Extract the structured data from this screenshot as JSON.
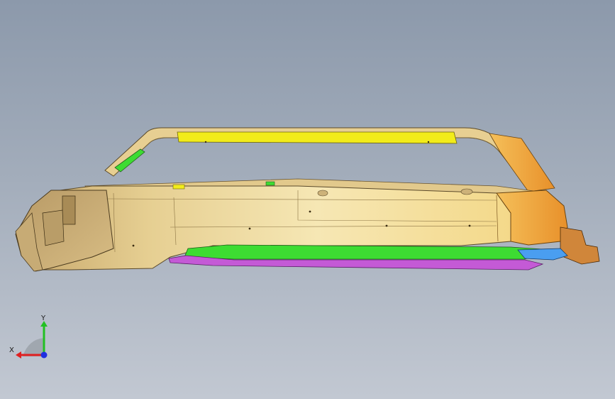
{
  "viewport": {
    "background_top": "#8c99ab",
    "background_bottom": "#c2c8d2"
  },
  "model": {
    "parts": [
      {
        "name": "body-panel",
        "color": "#f0dc9a"
      },
      {
        "name": "rear-section",
        "color": "#f0a53a"
      },
      {
        "name": "roof-rail-strip",
        "color": "#f2ec1a"
      },
      {
        "name": "sill-strip",
        "color": "#3ddc32"
      },
      {
        "name": "lower-trim",
        "color": "#c45ad6"
      },
      {
        "name": "bracket",
        "color": "#4a9ef0"
      }
    ]
  },
  "triad": {
    "x_label": "X",
    "y_label": "Y",
    "x_color": "#e02020",
    "y_color": "#22c022",
    "z_color": "#2030e0"
  }
}
